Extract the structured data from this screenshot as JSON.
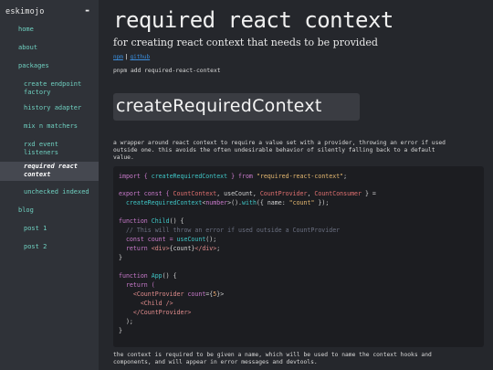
{
  "sidebar": {
    "brand": "eskimojo",
    "toggle": "-",
    "items": [
      {
        "label": "home"
      },
      {
        "label": "about"
      },
      {
        "label": "packages"
      },
      {
        "label": "create endpoint factory"
      },
      {
        "label": "history adapter"
      },
      {
        "label": "mix n matchers"
      },
      {
        "label": "rxd event listeners"
      },
      {
        "label": "required react context"
      },
      {
        "label": "unchecked indexed"
      },
      {
        "label": "blog"
      },
      {
        "label": "post 1"
      },
      {
        "label": "post 2"
      }
    ]
  },
  "main": {
    "title": "required react context",
    "subtitle": "for creating react context that needs to be provided",
    "links": [
      "npm",
      "github"
    ],
    "link_sep": "|",
    "install": "pnpm add required-react-context",
    "section_title": "createRequiredContext",
    "desc_lines": [
      "a wrapper around react context to require a value set with a provider, throwing an error if used",
      "outside one. this avoids the often undesirable behavior of silently falling back to a default",
      "value."
    ],
    "footer_lines": [
      "the context is required to be given a name, which will be used to name the context hooks and",
      "components, and will appear in error messages and devtools."
    ],
    "code": {
      "l1": [
        "import { ",
        "createRequiredContext",
        " } from ",
        "\"required-react-context\"",
        ";"
      ],
      "l2": [
        "export const { ",
        "CountContext",
        ", useCount, ",
        "CountProvider",
        ", ",
        "CountConsumer",
        " } ="
      ],
      "l3": [
        "  ",
        "createRequiredContext",
        "<",
        "number",
        ">().",
        "with",
        "({ name: ",
        "\"count\"",
        " });"
      ],
      "l4": [
        "function ",
        "Child",
        "() {"
      ],
      "l5": [
        "  // This will throw an error if used outside a CountProvider"
      ],
      "l6": [
        "  const count = ",
        "useCount",
        "();"
      ],
      "l7": [
        "  return ",
        "<div>",
        "{count}",
        "</div>",
        ";"
      ],
      "l8": [
        "}"
      ],
      "l9": [
        "function ",
        "App",
        "() {"
      ],
      "l10": [
        "  return ("
      ],
      "l11": [
        "    ",
        "<CountProvider",
        " count",
        "={",
        "5",
        "}>"
      ],
      "l12": [
        "      ",
        "<Child />"
      ],
      "l13": [
        "    ",
        "</CountProvider>"
      ],
      "l14": [
        "  );"
      ],
      "l15": [
        "}"
      ]
    }
  }
}
